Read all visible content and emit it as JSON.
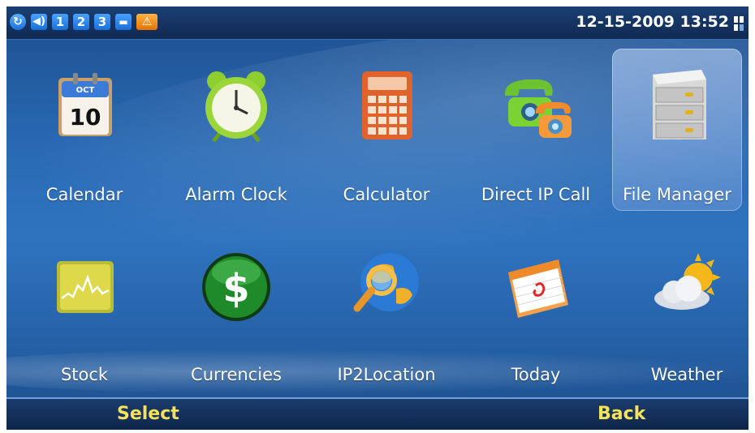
{
  "status_bar": {
    "icons": [
      "refresh-icon",
      "volume-icon",
      "line-1-icon",
      "line-2-icon",
      "line-3-icon",
      "keyboard-icon",
      "warning-icon"
    ],
    "line_numbers": [
      "1",
      "2",
      "3"
    ],
    "datetime": "12-15-2009 13:52"
  },
  "apps": [
    {
      "label": "Calendar",
      "icon": "calendar-icon",
      "month": "OCT",
      "day": "10"
    },
    {
      "label": "Alarm Clock",
      "icon": "alarm-clock-icon"
    },
    {
      "label": "Calculator",
      "icon": "calculator-icon"
    },
    {
      "label": "Direct IP Call",
      "icon": "phone-icon"
    },
    {
      "label": "File Manager",
      "icon": "file-cabinet-icon",
      "selected": true
    },
    {
      "label": "Stock",
      "icon": "stock-chart-icon"
    },
    {
      "label": "Currencies",
      "icon": "dollar-icon"
    },
    {
      "label": "IP2Location",
      "icon": "globe-search-icon"
    },
    {
      "label": "Today",
      "icon": "today-calendar-icon"
    },
    {
      "label": "Weather",
      "icon": "weather-icon"
    }
  ],
  "softkeys": {
    "left": "Select",
    "right": "Back"
  },
  "colors": {
    "background": "#2a6bb5",
    "softkey_text": "#f3e25a",
    "highlight": "#b9cdf0"
  }
}
